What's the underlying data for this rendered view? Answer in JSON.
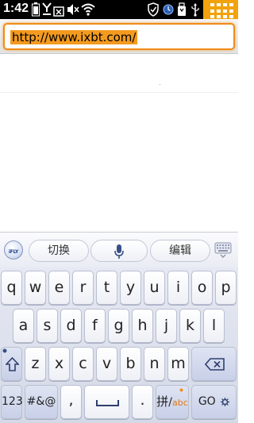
{
  "status_bar": {
    "time": "1:42",
    "icons": [
      "battery-icon",
      "signal-y-icon",
      "no-sim-icon",
      "mute-icon",
      "wifi-icon",
      "shield-icon",
      "clock-icon",
      "usb-storage-icon",
      "usb-icon",
      "grid-menu-icon"
    ],
    "accent": "#f2a20c"
  },
  "url_bar": {
    "url": "http://www.ixbt.com/",
    "highlight": "#f39a1f",
    "border": "#f08c1a"
  },
  "ime_bar": {
    "logo": "iFLY",
    "switch_label": "切换",
    "edit_label": "编辑",
    "icons": [
      "microphone-icon",
      "keyboard-hide-icon"
    ]
  },
  "keyboard": {
    "row1": [
      "q",
      "w",
      "e",
      "r",
      "t",
      "y",
      "u",
      "i",
      "o",
      "p"
    ],
    "row2": [
      "a",
      "s",
      "d",
      "f",
      "g",
      "h",
      "j",
      "k",
      "l"
    ],
    "row3": [
      "z",
      "x",
      "c",
      "v",
      "b",
      "n",
      "m"
    ],
    "shift_icon": "shift-icon",
    "backspace_icon": "backspace-icon",
    "num_label": "123",
    "symbols_label": "#&@",
    "comma_label": ",",
    "period_label": ".",
    "lang_label": "拼",
    "lang_alt": "abc",
    "go_label": "GO"
  }
}
